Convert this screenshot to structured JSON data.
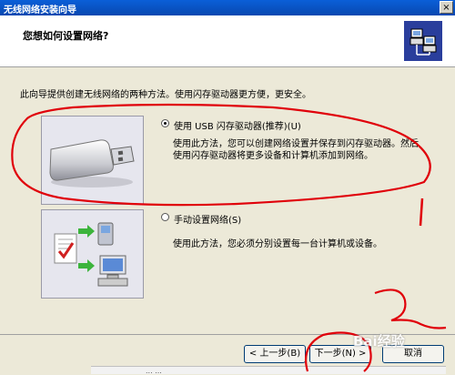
{
  "window": {
    "title": "无线网络安装向导",
    "close_label": "×"
  },
  "header": {
    "title": "您想如何设置网络?"
  },
  "intro": "此向导提供创建无线网络的两种方法。使用闪存驱动器更方便，更安全。",
  "options": [
    {
      "label": "使用 USB 闪存驱动器(推荐)(U)",
      "selected": true,
      "description": "使用此方法，您可以创建网络设置并保存到闪存驱动器。然后使用闪存驱动器将更多设备和计算机添加到网络。"
    },
    {
      "label": "手动设置网络(S)",
      "selected": false,
      "description": "使用此方法，您必须分别设置每一台计算机或设备。"
    }
  ],
  "buttons": {
    "back": "< 上一步(B)",
    "next": "下一步(N) >",
    "cancel": "取消"
  },
  "bottom_strip": "... ...",
  "watermark": "Bai经验",
  "colors": {
    "title_bar": "#0a5fd8",
    "annotation": "#e0000a"
  },
  "icons": {
    "wizard": "network-wizard-icon",
    "usb": "usb-flash-drive-icon",
    "manual": "network-computers-icon"
  }
}
